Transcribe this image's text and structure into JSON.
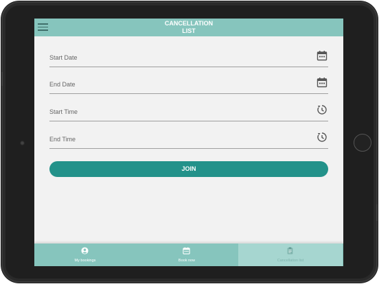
{
  "appbar": {
    "title_line1": "CANCELLATION",
    "title_line2": "LIST",
    "menu_icon": "hamburger-menu-icon"
  },
  "form": {
    "fields": [
      {
        "label": "Start Date",
        "icon": "calendar-icon"
      },
      {
        "label": "End Date",
        "icon": "calendar-icon"
      },
      {
        "label": "Start Time",
        "icon": "clock-icon"
      },
      {
        "label": "End Time",
        "icon": "clock-icon"
      }
    ],
    "join_label": "JOIN"
  },
  "bottom_nav": {
    "items": [
      {
        "label": "My bookings",
        "icon": "account-circle-icon",
        "active": false
      },
      {
        "label": "Book now",
        "icon": "calendar-icon",
        "active": false
      },
      {
        "label": "Cancellation list",
        "icon": "clipboard-icon",
        "active": true
      }
    ]
  },
  "colors": {
    "appbar": "#86c5bd",
    "primary_button": "#23928a",
    "screen_background": "#f2f2f2",
    "active_tab": "#a6d6d0"
  }
}
